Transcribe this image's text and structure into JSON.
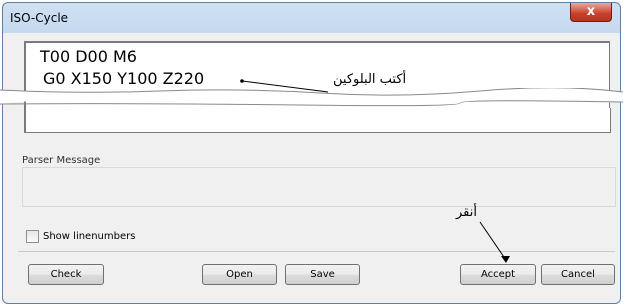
{
  "window": {
    "title": "ISO-Cycle",
    "close_glyph": "x"
  },
  "editor": {
    "lines": [
      "T00 D00 M6",
      "G0 X150 Y100 Z220"
    ]
  },
  "parser": {
    "label": "Parser Message",
    "message": ""
  },
  "options": {
    "show_linenumbers_label": "Show linenumbers",
    "show_linenumbers_checked": false
  },
  "buttons": {
    "check": "Check",
    "open": "Open",
    "save": "Save",
    "accept": "Accept",
    "cancel": "Cancel"
  },
  "annotations": {
    "write_block": "أكتب البلوكين",
    "click": "أنقر"
  },
  "colors": {
    "close_button": "#c7402a",
    "title_bar": "#cfe0f2"
  }
}
